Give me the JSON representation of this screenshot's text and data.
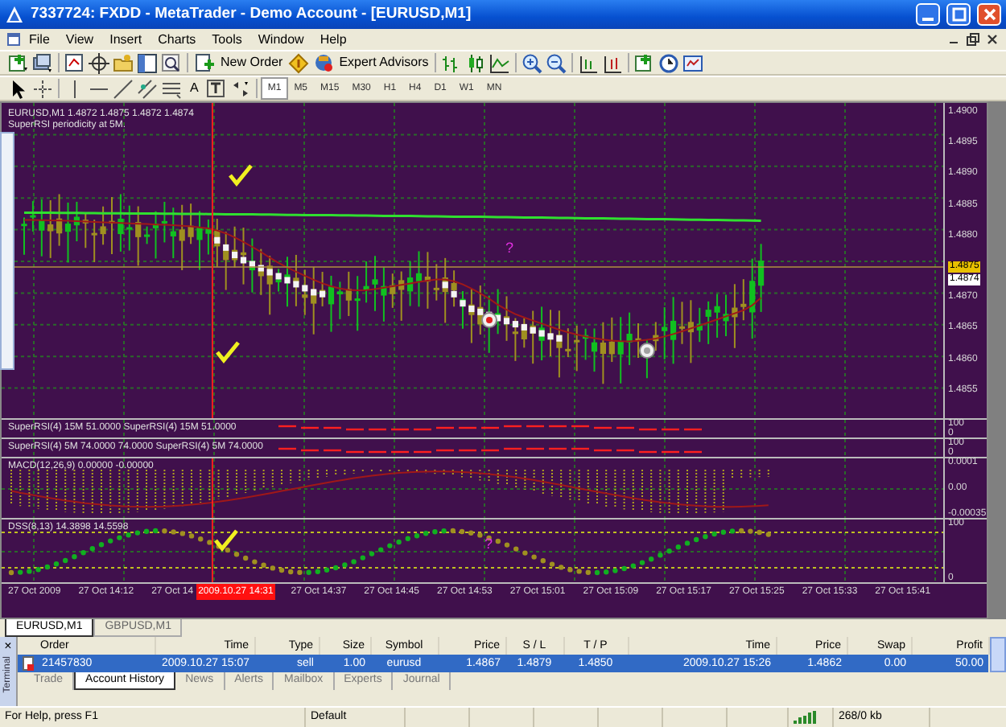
{
  "window": {
    "title": "7337724: FXDD - MetaTrader - Demo Account - [EURUSD,M1]"
  },
  "menu": [
    "File",
    "View",
    "Insert",
    "Charts",
    "Tools",
    "Window",
    "Help"
  ],
  "toolbar": {
    "new_order": "New Order",
    "expert_advisors": "Expert Advisors",
    "text_tool": "A"
  },
  "timeframes": [
    {
      "label": "M1",
      "selected": true
    },
    {
      "label": "M5",
      "selected": false
    },
    {
      "label": "M15",
      "selected": false
    },
    {
      "label": "M30",
      "selected": false
    },
    {
      "label": "H1",
      "selected": false
    },
    {
      "label": "H4",
      "selected": false
    },
    {
      "label": "D1",
      "selected": false
    },
    {
      "label": "W1",
      "selected": false
    },
    {
      "label": "MN",
      "selected": false
    }
  ],
  "chart": {
    "header": "EURUSD,M1  1.4872 1.4875 1.4872 1.4874",
    "subheader": "SuperRSI periodicity at 5M.",
    "marker_text": "?",
    "price_labels": [
      {
        "label": "1.4900",
        "kind": "tick"
      },
      {
        "label": "1.4895",
        "kind": "tick"
      },
      {
        "label": "1.4890",
        "kind": "tick"
      },
      {
        "label": "1.4885",
        "kind": "tick"
      },
      {
        "label": "1.4880",
        "kind": "tick"
      },
      {
        "label": "1.4875",
        "kind": "bid"
      },
      {
        "label": "1.4874",
        "kind": "ask"
      },
      {
        "label": "1.4870",
        "kind": "tick"
      },
      {
        "label": "1.4865",
        "kind": "tick"
      },
      {
        "label": "1.4860",
        "kind": "tick"
      },
      {
        "label": "1.4855",
        "kind": "tick"
      }
    ],
    "panes": [
      {
        "kind": "rsi",
        "label": "SuperRSI(4) 15M 51.0000  SuperRSI(4) 15M 51.0000",
        "axis": [
          "100",
          "0"
        ]
      },
      {
        "kind": "rsi",
        "label": "SuperRSI(4) 5M 74.0000 74.0000  SuperRSI(4) 5M 74.0000",
        "axis": [
          "100",
          "0"
        ]
      },
      {
        "kind": "macd",
        "label": "MACD(12,26,9) 0.00000 -0.00000",
        "axis": [
          "0.0001",
          "0.00",
          "-0.00035"
        ]
      },
      {
        "kind": "dss",
        "label": "DSS(8,13) 14.3898 14.5598",
        "axis": [
          "100",
          "0"
        ],
        "marker_text": "?"
      }
    ],
    "time_labels": [
      {
        "label": "27 Oct 2009",
        "highlighted": false
      },
      {
        "label": "27 Oct 14:12",
        "highlighted": false
      },
      {
        "label": "27 Oct 14",
        "highlighted": false
      },
      {
        "label": "2009.10.27 14:31",
        "highlighted": true
      },
      {
        "label": "27 Oct 14:37",
        "highlighted": false
      },
      {
        "label": "27 Oct 14:45",
        "highlighted": false
      },
      {
        "label": "27 Oct 14:53",
        "highlighted": false
      },
      {
        "label": "27 Oct 15:01",
        "highlighted": false
      },
      {
        "label": "27 Oct 15:09",
        "highlighted": false
      },
      {
        "label": "27 Oct 15:17",
        "highlighted": false
      },
      {
        "label": "27 Oct 15:25",
        "highlighted": false
      },
      {
        "label": "27 Oct 15:33",
        "highlighted": false
      },
      {
        "label": "27 Oct 15:41",
        "highlighted": false
      }
    ]
  },
  "chart_tabs": [
    {
      "label": "EURUSD,M1",
      "selected": true
    },
    {
      "label": "GBPUSD,M1",
      "selected": false
    }
  ],
  "terminal": {
    "close": "×",
    "side_label": "Terminal",
    "columns": [
      "Order",
      "Time",
      "Type",
      "Size",
      "Symbol",
      "Price",
      "S / L",
      "T / P",
      "Time",
      "Price",
      "Swap",
      "Profit"
    ],
    "rows": [
      {
        "selected": true,
        "cells": [
          "21457830",
          "2009.10.27 15:07",
          "sell",
          "1.00",
          "eurusd",
          "1.4867",
          "1.4879",
          "1.4850",
          "2009.10.27 15:26",
          "1.4862",
          "0.00",
          "50.00"
        ]
      }
    ],
    "tabs": [
      {
        "label": "Trade",
        "selected": false
      },
      {
        "label": "Account History",
        "selected": true
      },
      {
        "label": "News",
        "selected": false
      },
      {
        "label": "Alerts",
        "selected": false
      },
      {
        "label": "Mailbox",
        "selected": false
      },
      {
        "label": "Experts",
        "selected": false
      },
      {
        "label": "Journal",
        "selected": false
      }
    ]
  },
  "status_bar": {
    "help": "For Help, press F1",
    "profile": "Default",
    "traffic": "268/0 kb"
  }
}
